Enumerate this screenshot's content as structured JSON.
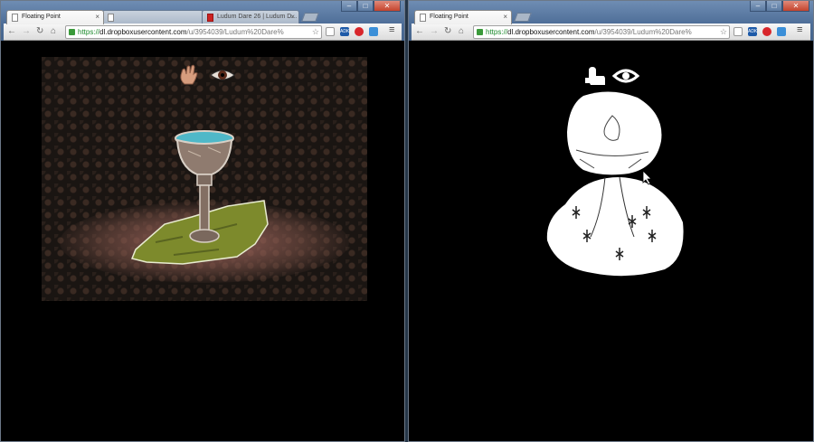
{
  "left_window": {
    "tabs": [
      {
        "title": "Floating Point",
        "active": true
      },
      {
        "title": "",
        "active": false
      },
      {
        "title": "Ludum Dare 26 | Ludum D...",
        "active": false
      }
    ],
    "url": {
      "scheme": "https://",
      "host": "dl.dropboxusercontent.com",
      "path": "/u/3954039/Ludum%20Dare%"
    }
  },
  "right_window": {
    "tabs": [
      {
        "title": "Floating Point",
        "active": true
      }
    ],
    "url": {
      "scheme": "https://",
      "host": "dl.dropboxusercontent.com",
      "path": "/u/3954039/Ludum%20Dare%"
    }
  },
  "window_controls": {
    "minimize": "–",
    "maximize": "□",
    "close": "✕"
  },
  "nav_glyphs": {
    "back": "←",
    "forward": "→",
    "reload": "↻",
    "home": "⌂"
  },
  "extension_labels": {
    "alexa": "ADK"
  },
  "icons": [
    "hand-icon",
    "eye-icon",
    "chalice-icon",
    "cursor-icon"
  ],
  "colors": {
    "chrome_blue": "#4d6d97",
    "url_green": "#1a8a2a",
    "game_bg": "#000000",
    "water": "#4fb8c8"
  }
}
